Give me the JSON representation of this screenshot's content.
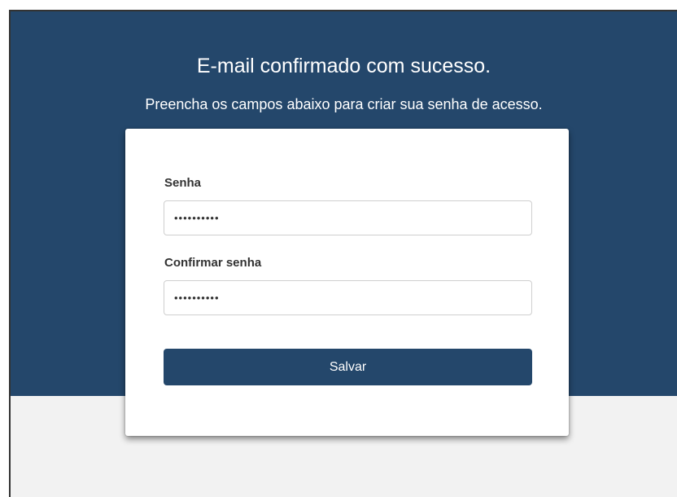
{
  "header": {
    "title": "E-mail confirmado com sucesso.",
    "subtitle": "Preencha os campos abaixo para criar sua senha de acesso."
  },
  "form": {
    "password": {
      "label": "Senha",
      "value": "••••••••••"
    },
    "confirm_password": {
      "label": "Confirmar senha",
      "value": "••••••••••"
    },
    "submit_label": "Salvar"
  },
  "colors": {
    "primary": "#24476b",
    "page_background": "#f2f2f2",
    "card_background": "#ffffff"
  }
}
